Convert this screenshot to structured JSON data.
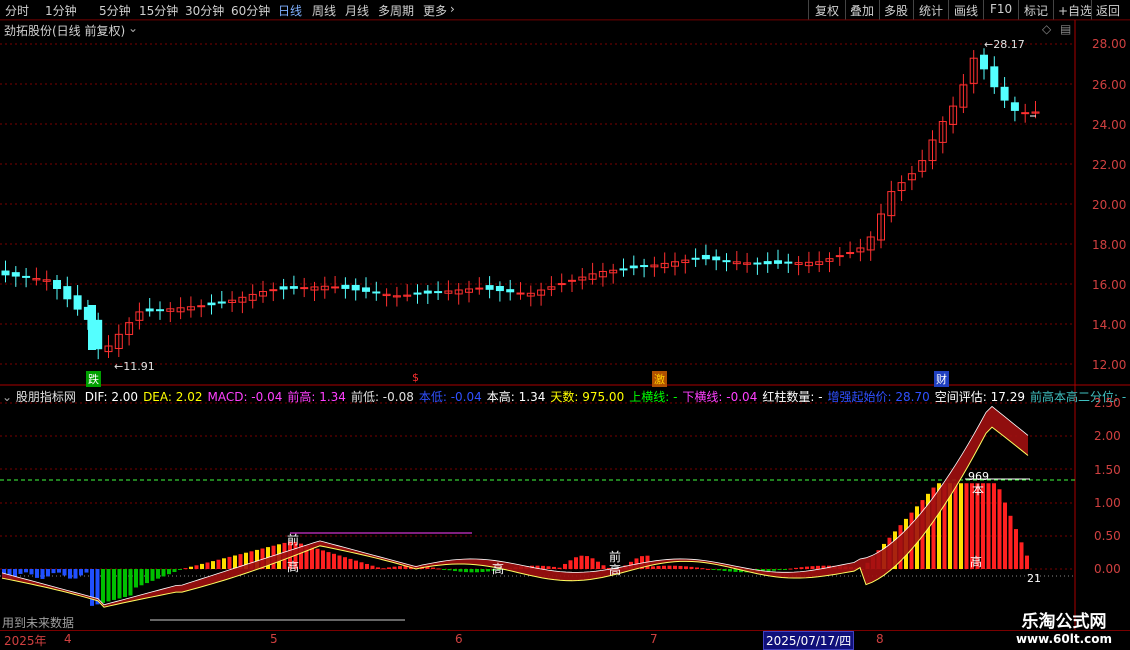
{
  "toolbar": {
    "items": [
      "分时",
      "1分钟",
      "5分钟",
      "15分钟",
      "30分钟",
      "60分钟",
      "日线",
      "周线",
      "月线",
      "多周期",
      "更多"
    ],
    "right_items": [
      "复权",
      "叠加",
      "多股",
      "统计",
      "画线",
      "F10",
      "标记",
      "+自选",
      "返回"
    ]
  },
  "main_chart": {
    "title": "劲拓股份(日线 前复权)",
    "y_ticks": [
      "28.00",
      "26.00",
      "24.00",
      "22.00",
      "20.00",
      "18.00",
      "16.00",
      "14.00",
      "12.00"
    ],
    "high_label": "28.17",
    "low_label": "11.91",
    "markers": [
      "跌",
      "$",
      "激",
      "财"
    ],
    "colors": {
      "up": "#ff3030",
      "down": "#54ffff",
      "grid": "#7a0000"
    }
  },
  "indicator": {
    "name": "股朋指标网",
    "fields": [
      {
        "label": "DIF: ",
        "value": "2.00",
        "color": "#ffffff"
      },
      {
        "label": "DEA: ",
        "value": "2.02",
        "color": "#ffff00"
      },
      {
        "label": "MACD: ",
        "value": "-0.04",
        "color": "#ff40ff"
      },
      {
        "label": "前高: ",
        "value": "1.34",
        "color": "#ff40ff"
      },
      {
        "label": "前低: ",
        "value": "-0.08",
        "color": "#e0e0e0"
      },
      {
        "label": "本低: ",
        "value": "-0.04",
        "color": "#3050ff"
      },
      {
        "label": "本高: ",
        "value": "1.34",
        "color": "#ffffff"
      },
      {
        "label": "天数: ",
        "value": "975.00",
        "color": "#ffff00"
      },
      {
        "label": "上横线: ",
        "value": "-",
        "color": "#00ff00"
      },
      {
        "label": "下横线: ",
        "value": "-0.04",
        "color": "#ff40ff"
      },
      {
        "label": "红柱数量: ",
        "value": "-",
        "color": "#ffffff"
      },
      {
        "label": "增强起始价: ",
        "value": "28.70",
        "color": "#3050ff"
      },
      {
        "label": "空间评估: ",
        "value": "17.29",
        "color": "#ffffff"
      },
      {
        "label": "前高本高二分位: ",
        "value": "-",
        "color": "#40c0c0"
      }
    ],
    "y_ticks": [
      "2.50",
      "2.00",
      "1.50",
      "1.00",
      "0.50",
      "0.00"
    ],
    "annotations": [
      "前",
      "高",
      "高",
      "前",
      "高",
      "969",
      "本",
      "高",
      "21"
    ],
    "footer_note": "用到未来数据"
  },
  "time_axis": {
    "labels": [
      "2025年",
      "4",
      "5",
      "6",
      "7",
      "8"
    ],
    "cursor_date": "2025/07/17/四"
  },
  "watermark": {
    "title": "乐淘公式网",
    "url": "www.60lt.com"
  }
}
